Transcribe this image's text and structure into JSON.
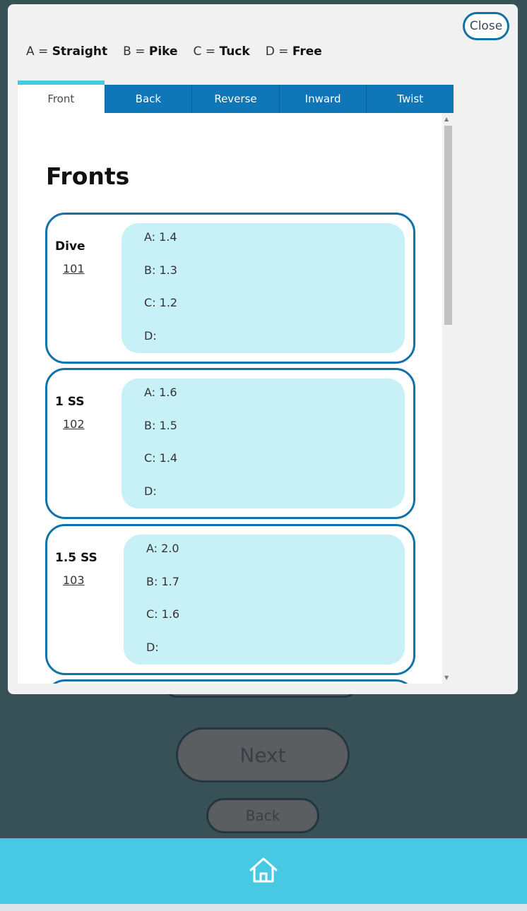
{
  "modal": {
    "close_label": "Close",
    "legend": [
      {
        "key": "A =",
        "value": "Straight"
      },
      {
        "key": "B =",
        "value": "Pike"
      },
      {
        "key": "C =",
        "value": "Tuck"
      },
      {
        "key": "D =",
        "value": "Free"
      }
    ],
    "tabs": [
      "Front",
      "Back",
      "Reverse",
      "Inward",
      "Twist"
    ],
    "active_tab": "Front",
    "section_title": "Fronts",
    "dives": [
      {
        "name": "Dive",
        "number": "101",
        "rows": [
          "A: 1.4",
          "B: 1.3",
          "C: 1.2",
          "D:"
        ]
      },
      {
        "name": "1 SS",
        "number": "102",
        "rows": [
          "A: 1.6",
          "B: 1.5",
          "C: 1.4",
          "D:"
        ]
      },
      {
        "name": "1.5 SS",
        "number": "103",
        "rows": [
          "A: 2.0",
          "B: 1.7",
          "C: 1.6",
          "D:"
        ]
      }
    ]
  },
  "background": {
    "next_label": "Next",
    "back_label": "Back"
  },
  "footer": {
    "home_icon": "home-icon"
  },
  "colors": {
    "accent": "#47c8e3",
    "primary": "#0f77b8",
    "card_fill": "#c8f0f7"
  }
}
